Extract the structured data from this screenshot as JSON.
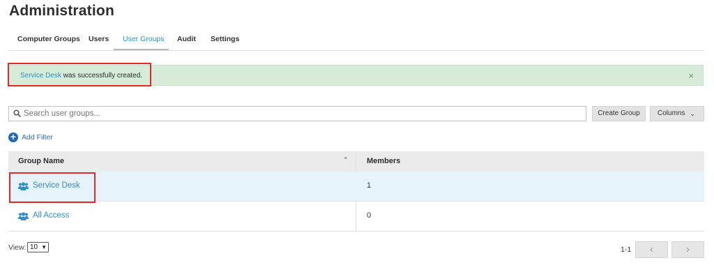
{
  "page": {
    "title": "Administration"
  },
  "tabs": [
    {
      "label": "Computer Groups"
    },
    {
      "label": "Users"
    },
    {
      "label": "User Groups",
      "active": true
    },
    {
      "label": "Audit"
    },
    {
      "label": "Settings"
    }
  ],
  "alert": {
    "link_text": "Service Desk",
    "message": " was successfully created.",
    "close": "×"
  },
  "toolbar": {
    "search_placeholder": "Search user groups...",
    "create_label": "Create Group",
    "columns_label": "Columns"
  },
  "filter": {
    "add_label": "Add Filter"
  },
  "table": {
    "headers": [
      "Group Name",
      "Members"
    ],
    "rows": [
      {
        "name": "Service Desk",
        "members": "1"
      },
      {
        "name": "All Access",
        "members": "0"
      }
    ]
  },
  "footer": {
    "view_label": "View:",
    "view_value": "10",
    "range": "1-1"
  },
  "colors": {
    "accent": "#2e8fc6",
    "alert_bg": "#d6ecd9",
    "highlight": "#e32828",
    "selected_row": "#e6f3fb"
  }
}
